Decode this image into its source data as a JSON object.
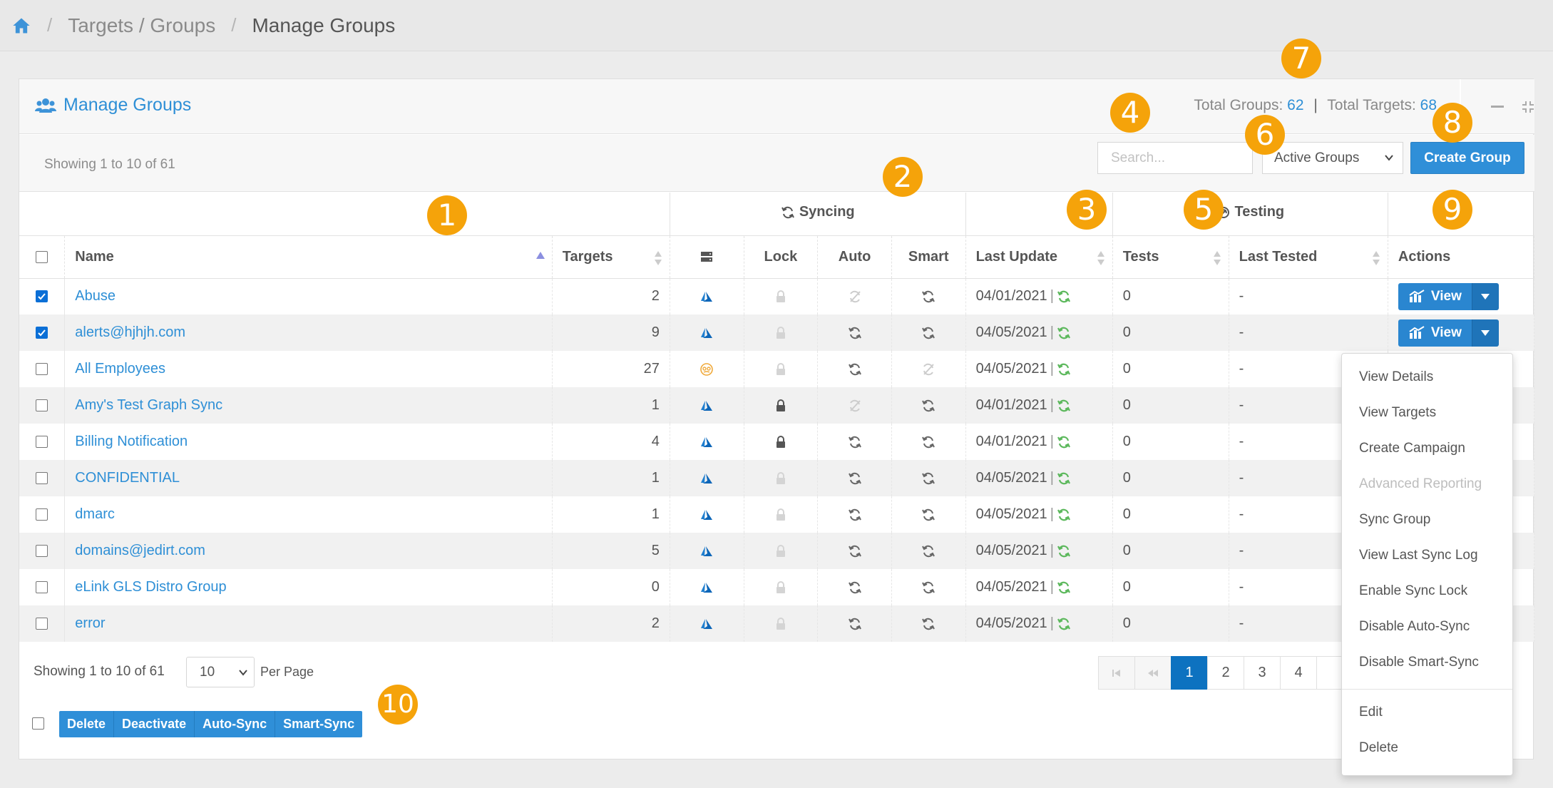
{
  "breadcrumb": {
    "crumb1": "Targets / Groups",
    "current": "Manage Groups"
  },
  "panel": {
    "title": "Manage Groups",
    "total_groups_label": "Total Groups:",
    "total_groups": "62",
    "total_targets_label": "Total Targets:",
    "total_targets": "68"
  },
  "toolbar": {
    "showing": "Showing 1 to 10 of 61",
    "search_placeholder": "Search...",
    "filter_selected": "Active Groups",
    "create_label": "Create Group"
  },
  "table": {
    "group_syncing": "Syncing",
    "group_testing": "Testing",
    "headers": {
      "name": "Name",
      "targets": "Targets",
      "lock": "Lock",
      "auto": "Auto",
      "smart": "Smart",
      "last_update": "Last Update",
      "tests": "Tests",
      "last_tested": "Last Tested",
      "actions": "Actions"
    },
    "view_label": "View",
    "rows": [
      {
        "name": "Abuse",
        "targets": "2",
        "source": "azure",
        "locked": false,
        "auto": false,
        "smart": true,
        "last_update": "04/01/2021",
        "tests": "0",
        "last_tested": "-",
        "checked": true
      },
      {
        "name": "alerts@hjhjh.com",
        "targets": "9",
        "source": "azure",
        "locked": false,
        "auto": true,
        "smart": true,
        "last_update": "04/05/2021",
        "tests": "0",
        "last_tested": "-",
        "checked": true
      },
      {
        "name": "All Employees",
        "targets": "27",
        "source": "ldap",
        "locked": false,
        "auto": true,
        "smart": false,
        "last_update": "04/05/2021",
        "tests": "0",
        "last_tested": "-",
        "checked": false
      },
      {
        "name": "Amy's Test Graph Sync",
        "targets": "1",
        "source": "azure",
        "locked": true,
        "auto": false,
        "smart": true,
        "last_update": "04/01/2021",
        "tests": "0",
        "last_tested": "-",
        "checked": false
      },
      {
        "name": "Billing Notification",
        "targets": "4",
        "source": "azure",
        "locked": true,
        "auto": true,
        "smart": true,
        "last_update": "04/01/2021",
        "tests": "0",
        "last_tested": "-",
        "checked": false
      },
      {
        "name": "CONFIDENTIAL",
        "targets": "1",
        "source": "azure",
        "locked": false,
        "auto": true,
        "smart": true,
        "last_update": "04/05/2021",
        "tests": "0",
        "last_tested": "-",
        "checked": false
      },
      {
        "name": "dmarc",
        "targets": "1",
        "source": "azure",
        "locked": false,
        "auto": true,
        "smart": true,
        "last_update": "04/05/2021",
        "tests": "0",
        "last_tested": "-",
        "checked": false
      },
      {
        "name": "domains@jedirt.com",
        "targets": "5",
        "source": "azure",
        "locked": false,
        "auto": true,
        "smart": true,
        "last_update": "04/05/2021",
        "tests": "0",
        "last_tested": "-",
        "checked": false
      },
      {
        "name": "eLink GLS Distro Group",
        "targets": "0",
        "source": "azure",
        "locked": false,
        "auto": true,
        "smart": true,
        "last_update": "04/05/2021",
        "tests": "0",
        "last_tested": "-",
        "checked": false
      },
      {
        "name": "error",
        "targets": "2",
        "source": "azure",
        "locked": false,
        "auto": true,
        "smart": true,
        "last_update": "04/05/2021",
        "tests": "0",
        "last_tested": "-",
        "checked": false
      }
    ]
  },
  "footer": {
    "showing": "Showing 1 to 10 of 61",
    "per_page_value": "10",
    "per_page_label": "Per Page",
    "pages": [
      "1",
      "2",
      "3",
      "4"
    ],
    "active_page": "1"
  },
  "bulk_actions": [
    "Delete",
    "Deactivate",
    "Auto-Sync",
    "Smart-Sync"
  ],
  "dropdown_menu": [
    {
      "label": "View Details",
      "disabled": false
    },
    {
      "label": "View Targets",
      "disabled": false
    },
    {
      "label": "Create Campaign",
      "disabled": false
    },
    {
      "label": "Advanced Reporting",
      "disabled": true
    },
    {
      "label": "Sync Group",
      "disabled": false
    },
    {
      "label": "View Last Sync Log",
      "disabled": false
    },
    {
      "label": "Enable Sync Lock",
      "disabled": false
    },
    {
      "label": "Disable Auto-Sync",
      "disabled": false
    },
    {
      "label": "Disable Smart-Sync",
      "disabled": false
    },
    {
      "label": "Edit",
      "disabled": false
    },
    {
      "label": "Delete",
      "disabled": false
    }
  ],
  "callouts": [
    "1",
    "2",
    "3",
    "4",
    "5",
    "6",
    "7",
    "8",
    "9",
    "10"
  ],
  "colors": {
    "accent": "#2e8fd6",
    "callout": "#f5a30a",
    "sync_green": "#5cb85c",
    "active_page": "#0d72c0"
  }
}
